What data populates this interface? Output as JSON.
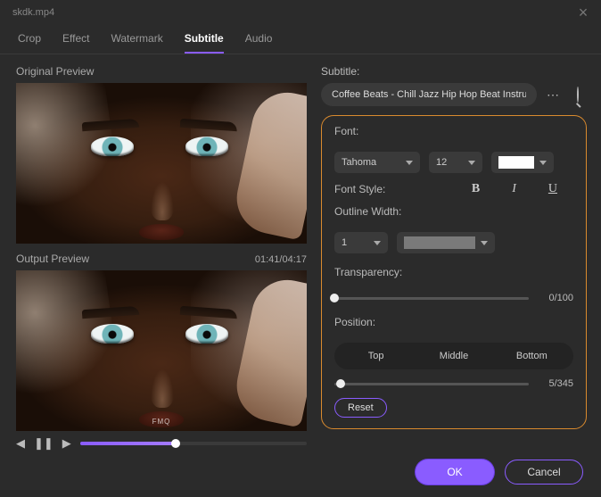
{
  "title": "skdk.mp4",
  "tabs": [
    "Crop",
    "Effect",
    "Watermark",
    "Subtitle",
    "Audio"
  ],
  "active_tab": 3,
  "left": {
    "original_label": "Original Preview",
    "output_label": "Output Preview",
    "time": "01:41/04:17",
    "watermark": "FMQ"
  },
  "subtitle": {
    "label": "Subtitle:",
    "value": "Coffee Beats - Chill Jazz Hip Hop Beat Instru"
  },
  "font": {
    "label": "Font:",
    "family": "Tahoma",
    "size": "12",
    "color": "#ffffff",
    "style_label": "Font Style:",
    "bold": "B",
    "italic": "I",
    "underline": "U"
  },
  "outline": {
    "label": "Outline Width:",
    "width": "1",
    "color": "#7a7a7a"
  },
  "transparency": {
    "label": "Transparency:",
    "value": "0/100",
    "pct": 0
  },
  "position": {
    "label": "Position:",
    "options": [
      "Top",
      "Middle",
      "Bottom"
    ],
    "slider_value": "5/345",
    "pct": 3
  },
  "reset": "Reset",
  "ok": "OK",
  "cancel": "Cancel"
}
